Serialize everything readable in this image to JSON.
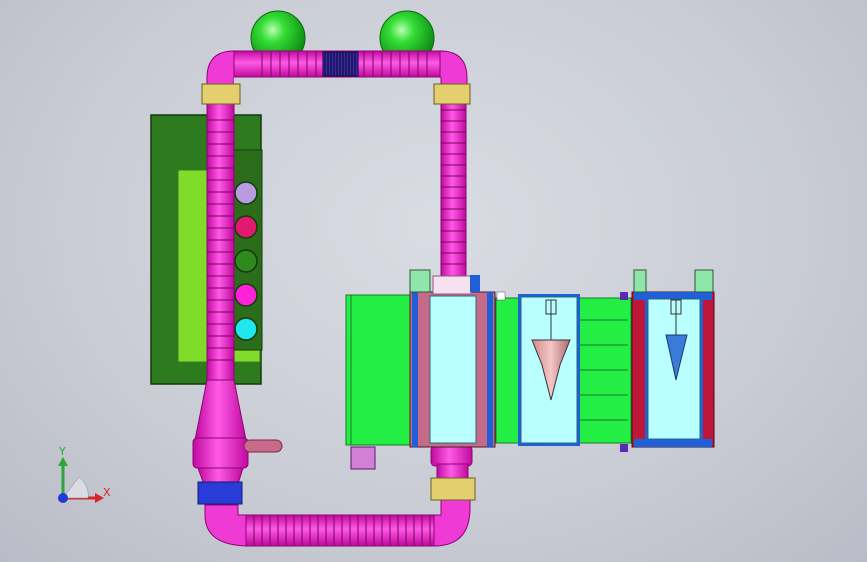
{
  "viewport": {
    "background_top": "#d9dce3",
    "background_bottom": "#b9bcc6"
  },
  "triad": {
    "x_label": "X",
    "y_label": "Y",
    "x_color": "#d6262b",
    "y_color": "#2aa63c",
    "z_color": "#1f3bd6"
  },
  "colors": {
    "pipe": "#ff1fd0",
    "pipe_dark": "#b0088f",
    "sphere": "#22cc22",
    "panel_dark": "#2e7a1e",
    "panel_light": "#7fdc2a",
    "bright_green": "#22ee44",
    "cyan_box": "#b9ffff",
    "rose_box": "#c66a8a",
    "red_wall": "#c0163a",
    "bracket": "#e3cf6e",
    "blue_bracket": "#2a3cd8",
    "violet_box": "#d27fd6"
  },
  "buttons": [
    {
      "name": "lavender",
      "color": "#b89be0"
    },
    {
      "name": "crimson",
      "color": "#e01a6e"
    },
    {
      "name": "green",
      "color": "#2f8a1e"
    },
    {
      "name": "magenta",
      "color": "#ff22d8"
    },
    {
      "name": "cyan",
      "color": "#22e6ee"
    }
  ]
}
